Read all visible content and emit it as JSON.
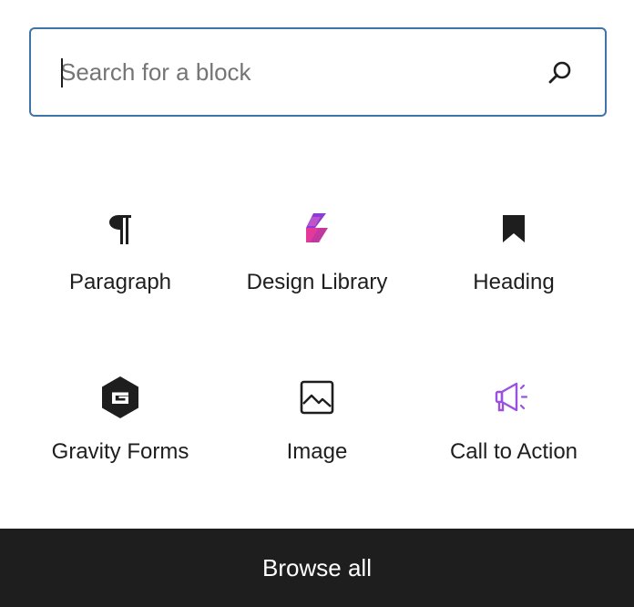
{
  "search": {
    "placeholder": "Search for a block",
    "value": ""
  },
  "blocks": [
    {
      "label": "Paragraph",
      "icon": "paragraph-icon"
    },
    {
      "label": "Design Library",
      "icon": "design-library-icon"
    },
    {
      "label": "Heading",
      "icon": "bookmark-icon"
    },
    {
      "label": "Gravity Forms",
      "icon": "gravity-forms-icon"
    },
    {
      "label": "Image",
      "icon": "image-icon"
    },
    {
      "label": "Call to Action",
      "icon": "megaphone-icon"
    }
  ],
  "footer": {
    "browse_all_label": "Browse all"
  },
  "colors": {
    "focus_border": "#3f74a8",
    "text": "#1e1e1e",
    "placeholder": "#757575",
    "footer_bg": "#1e1e1e",
    "cta_accent": "#9b51e0",
    "design_library_pink": "#e4399a",
    "design_library_purple": "#8e3ad6"
  }
}
